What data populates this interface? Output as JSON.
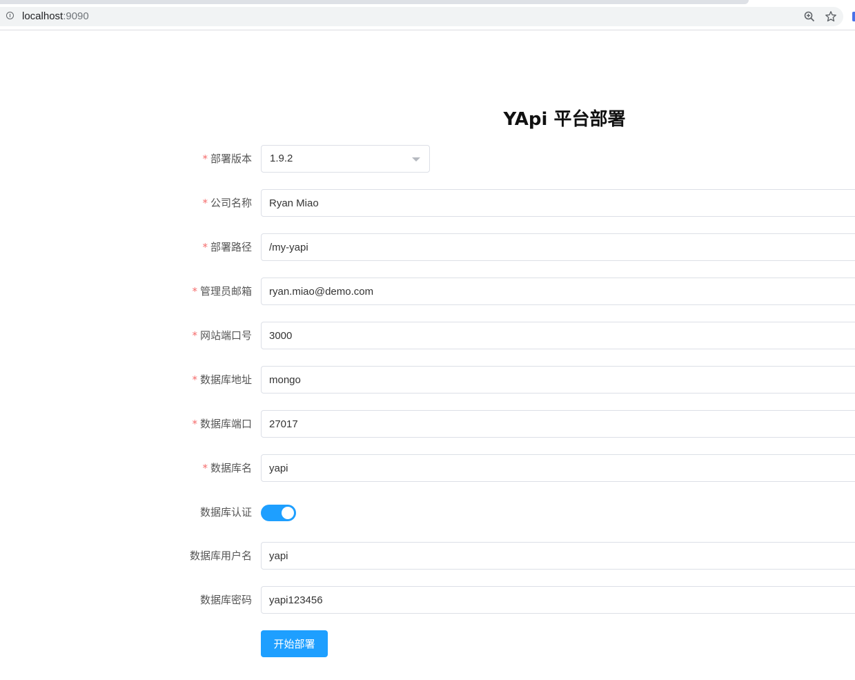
{
  "browser": {
    "url_host": "localhost",
    "url_port": ":9090"
  },
  "page": {
    "title": "YApi 平台部署"
  },
  "form": {
    "required_mark": "*",
    "version": {
      "label": "部署版本",
      "value": "1.9.2"
    },
    "company": {
      "label": "公司名称",
      "value": "Ryan Miao"
    },
    "path": {
      "label": "部署路径",
      "value": "/my-yapi"
    },
    "admin_email": {
      "label": "管理员邮箱",
      "value": "ryan.miao@demo.com"
    },
    "site_port": {
      "label": "网站端口号",
      "value": "3000"
    },
    "db_address": {
      "label": "数据库地址",
      "value": "mongo"
    },
    "db_port": {
      "label": "数据库端口",
      "value": "27017"
    },
    "db_name": {
      "label": "数据库名",
      "value": "yapi"
    },
    "db_auth": {
      "label": "数据库认证",
      "enabled": true
    },
    "db_user": {
      "label": "数据库用户名",
      "value": "yapi"
    },
    "db_password": {
      "label": "数据库密码",
      "value": "yapi123456"
    },
    "submit_label": "开始部署"
  },
  "colors": {
    "primary": "#1e9fff",
    "required": "#f56c6c",
    "border": "#dcdfe6"
  }
}
